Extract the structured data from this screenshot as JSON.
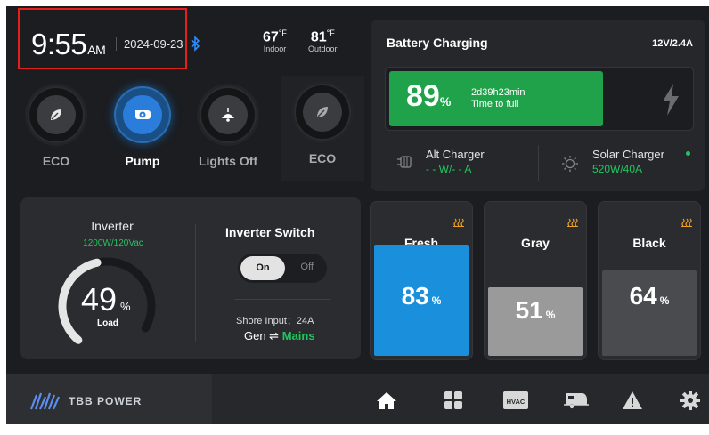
{
  "header": {
    "time": "9:55",
    "ampm": "AM",
    "date": "2024-09-23",
    "indoor": {
      "value": "67",
      "unit": "°F",
      "label": "Indoor"
    },
    "outdoor": {
      "value": "81",
      "unit": "°F",
      "label": "Outdoor"
    }
  },
  "modes": [
    {
      "label": "ECO",
      "icon": "leaf-icon",
      "active": false
    },
    {
      "label": "Pump",
      "icon": "pump-icon",
      "active": true
    },
    {
      "label": "Lights Off",
      "icon": "lamp-icon",
      "active": false
    },
    {
      "label": "ECO",
      "icon": "leaf-icon",
      "active": false
    }
  ],
  "battery": {
    "title": "Battery Charging",
    "rating": "12V/2.4A",
    "percent": "89",
    "percent_unit": "%",
    "level": 0.89,
    "time": "2d39h23min",
    "time_label": "Time to full",
    "alt_charger": {
      "label": "Alt Charger",
      "value": "- - W/- - A"
    },
    "solar_charger": {
      "label": "Solar Charger",
      "value": "520W/40A"
    }
  },
  "inverter": {
    "title": "Inverter",
    "rating": "1200W/120Vac",
    "load": "49",
    "load_unit": "%",
    "load_label": "Load",
    "level": 0.49,
    "switch_title": "Inverter Switch",
    "on_label": "On",
    "off_label": "Off",
    "shore_input": "Shore Input：24A",
    "gen_label": "Gen ⇌",
    "mains_label": "Mains"
  },
  "tanks": [
    {
      "name": "Fresh",
      "percent": "83",
      "unit": "%",
      "level": 0.83,
      "color": "#1a8fdc"
    },
    {
      "name": "Gray",
      "percent": "51",
      "unit": "%",
      "level": 0.51,
      "color": "#9a9a9a"
    },
    {
      "name": "Black",
      "percent": "64",
      "unit": "%",
      "level": 0.64,
      "color": "#4a4b4e"
    }
  ],
  "nav": {
    "brand": "TBB POWER",
    "items": [
      "home-icon",
      "grid-icon",
      "hvac-icon",
      "rv-icon",
      "warning-icon",
      "settings-icon"
    ],
    "hvac_label": "HVAC"
  },
  "colors": {
    "accent_green": "#22c55e",
    "accent_blue": "#2a7ddb",
    "alert_orange": "#f0a020"
  }
}
